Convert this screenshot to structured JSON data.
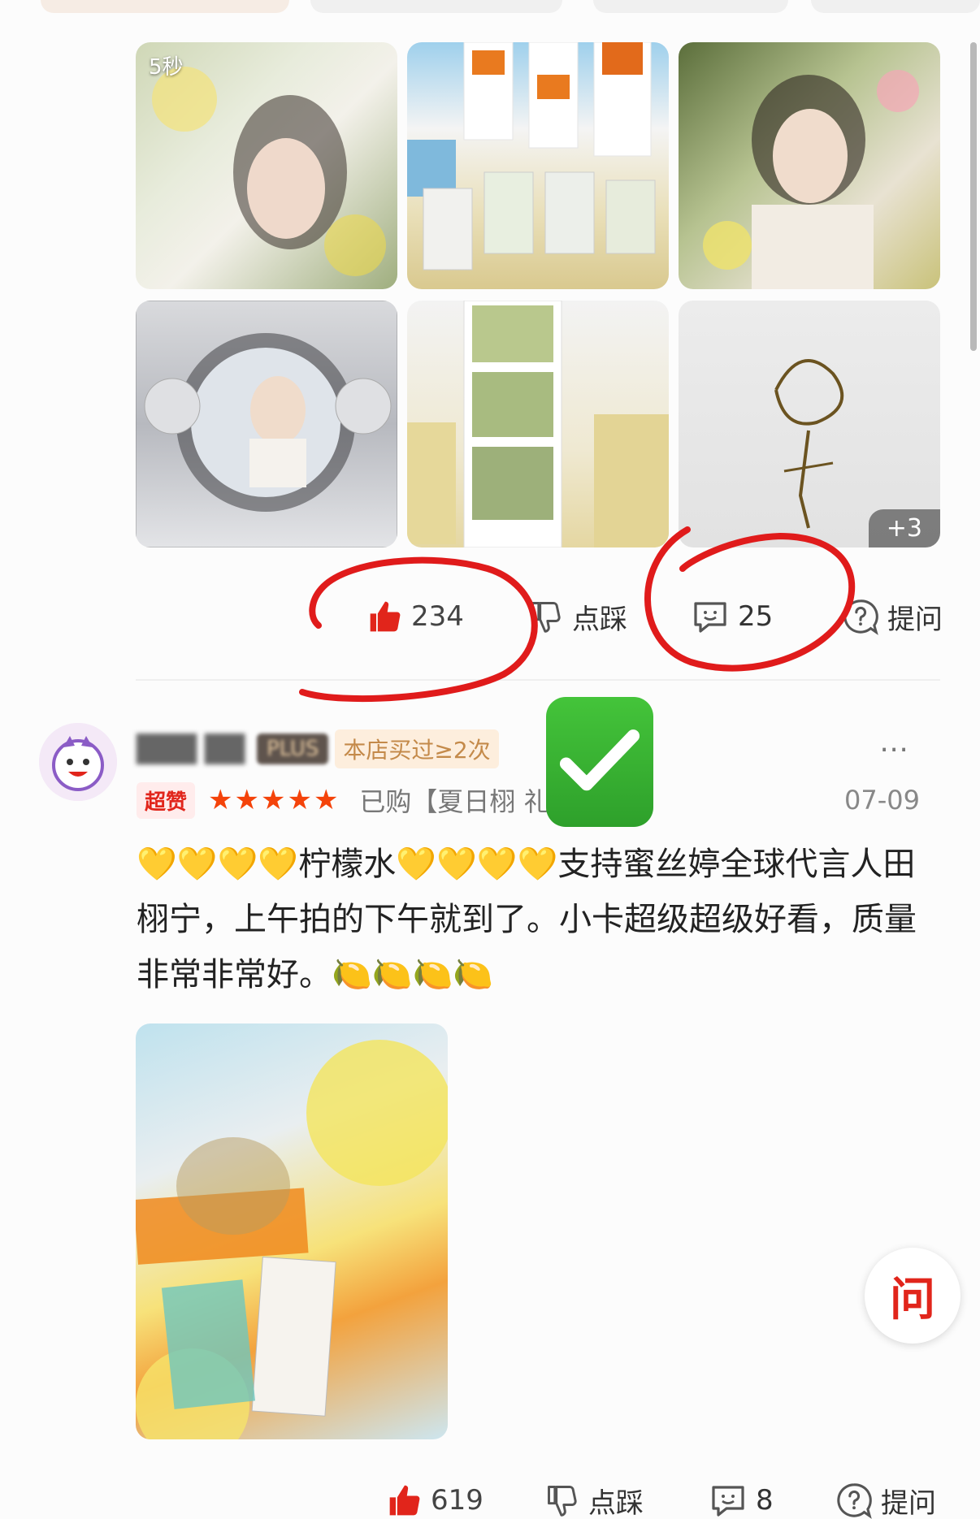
{
  "review_1": {
    "gallery": {
      "video_duration": "5秒",
      "more_count": "+3"
    },
    "actions": {
      "like_count": "234",
      "dislike_label": "点踩",
      "comment_count": "25",
      "ask_label": "提问"
    }
  },
  "review_2": {
    "user": {
      "membership": "PLUS",
      "purchase_badge": "本店买过≥2次"
    },
    "rating_tag": "超赞",
    "stars": "★★★★★",
    "purchased_item": "已购【夏日栩   礼盒】",
    "date": "07-09",
    "text": "💛💛💛💛柠檬水💛💛💛💛支持蜜丝婷全球代言人田栩宁，上午拍的下午就到了。小卡超级超级好看，质量非常非常好。🍋🍋🍋🍋",
    "actions": {
      "like_count": "619",
      "dislike_label": "点踩",
      "comment_count": "8",
      "ask_label": "提问"
    }
  },
  "floating_ask_label": "问",
  "colors": {
    "accent_red": "#e1251b",
    "check_green": "#3cb531",
    "star_orange": "#f4430a"
  }
}
